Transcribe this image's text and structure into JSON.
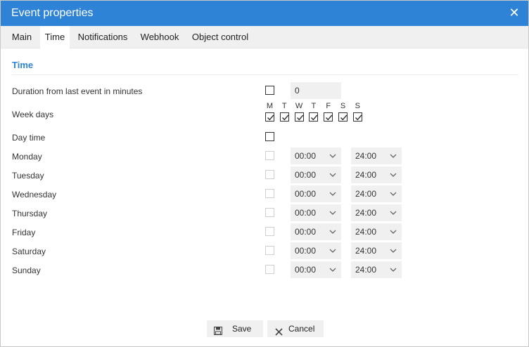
{
  "dialog": {
    "title": "Event properties",
    "close_glyph": "✕"
  },
  "tabs": [
    {
      "label": "Main",
      "active": false
    },
    {
      "label": "Time",
      "active": true
    },
    {
      "label": "Notifications",
      "active": false
    },
    {
      "label": "Webhook",
      "active": false
    },
    {
      "label": "Object control",
      "active": false
    }
  ],
  "section": {
    "title": "Time"
  },
  "fields": {
    "duration_label": "Duration from last event in minutes",
    "duration_enabled": false,
    "duration_value": "0",
    "weekdays_label": "Week days",
    "weekday_letters": [
      "M",
      "T",
      "W",
      "T",
      "F",
      "S",
      "S"
    ],
    "weekday_checked": [
      true,
      true,
      true,
      true,
      true,
      true,
      true
    ],
    "daytime_label": "Day time",
    "daytime_enabled": false
  },
  "days": [
    {
      "name": "Monday",
      "from": "00:00",
      "to": "24:00",
      "enabled": false
    },
    {
      "name": "Tuesday",
      "from": "00:00",
      "to": "24:00",
      "enabled": false
    },
    {
      "name": "Wednesday",
      "from": "00:00",
      "to": "24:00",
      "enabled": false
    },
    {
      "name": "Thursday",
      "from": "00:00",
      "to": "24:00",
      "enabled": false
    },
    {
      "name": "Friday",
      "from": "00:00",
      "to": "24:00",
      "enabled": false
    },
    {
      "name": "Saturday",
      "from": "00:00",
      "to": "24:00",
      "enabled": false
    },
    {
      "name": "Sunday",
      "from": "00:00",
      "to": "24:00",
      "enabled": false
    }
  ],
  "buttons": {
    "save": {
      "label": "Save",
      "icon": "floppy-disk-icon"
    },
    "cancel": {
      "label": "Cancel",
      "icon": "close-icon"
    }
  },
  "colors": {
    "accent": "#2f83d6",
    "field_bg": "#f0f0f0"
  }
}
